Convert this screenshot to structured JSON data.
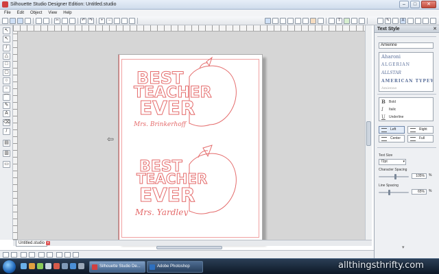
{
  "window": {
    "title": "Silhouette Studio Designer Edition: Untitled.studio"
  },
  "menu": [
    "File",
    "Edit",
    "Object",
    "View",
    "Help"
  ],
  "canvas": {
    "design1": {
      "line1": "BEST",
      "line2": "TEACHER",
      "line3": "EVER",
      "name": "Mrs. Brinkerhoff"
    },
    "design2": {
      "line1": "BEST",
      "line2": "TEACHER",
      "line3": "EVER",
      "name": "Mrs. Yardley"
    }
  },
  "doc_tab": {
    "label": "Untitled.studio"
  },
  "panel": {
    "title": "Text Style",
    "font_input": "Amienne",
    "font_list": [
      "Aharoni",
      "ALGERIAN",
      "ALLSTAR",
      "AMERICAN TYPEWRITER",
      "Amienne"
    ],
    "styles": [
      {
        "glyph": "B",
        "label": "Bold"
      },
      {
        "glyph": "I",
        "label": "Italic"
      },
      {
        "glyph": "U",
        "label": "Underline"
      }
    ],
    "align": {
      "left": "Left",
      "right": "Right",
      "center": "Center",
      "full": "Full"
    },
    "text_size_label": "Text Size",
    "text_size_value": "72pt",
    "char_spacing_label": "Character Spacing",
    "char_spacing_value": "105%",
    "line_spacing_label": "Line Spacing",
    "line_spacing_value": "65%",
    "percent_sign": "%",
    "char_spacing_level": 0.55,
    "line_spacing_level": 0.35
  },
  "taskbar": {
    "items": [
      {
        "label": "Silhouette Studio De...",
        "active": true
      },
      {
        "label": "Adobe Photoshop",
        "active": false
      }
    ]
  },
  "watermark": "allthingsthrifty.com",
  "colors": {
    "outline": "#e46a6a",
    "canvas": "#d6d6d6",
    "panel": "#eef0f3"
  }
}
